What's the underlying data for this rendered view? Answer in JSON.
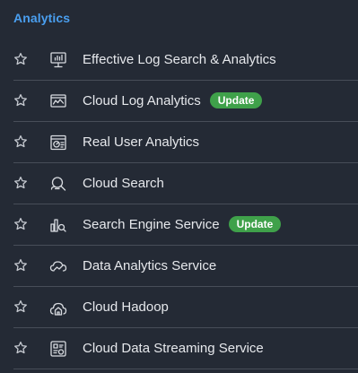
{
  "section": {
    "title": "Analytics"
  },
  "items": [
    {
      "label": "Effective Log Search & Analytics",
      "badge": "",
      "icon": "monitor-chart-icon"
    },
    {
      "label": "Cloud Log Analytics",
      "badge": "Update",
      "icon": "log-chart-icon"
    },
    {
      "label": "Real User Analytics",
      "badge": "",
      "icon": "browser-gauge-icon"
    },
    {
      "label": "Cloud Search",
      "badge": "",
      "icon": "cloud-search-icon"
    },
    {
      "label": "Search Engine Service",
      "badge": "Update",
      "icon": "bars-search-icon"
    },
    {
      "label": "Data Analytics Service",
      "badge": "",
      "icon": "cloud-trend-icon"
    },
    {
      "label": "Cloud Hadoop",
      "badge": "",
      "icon": "cloud-house-icon"
    },
    {
      "label": "Cloud Data Streaming Service",
      "badge": "",
      "icon": "streaming-icon"
    }
  ],
  "colors": {
    "background": "#242a35",
    "title": "#4a9ff0",
    "badge": "#3fa14a",
    "divider": "#474d58"
  }
}
